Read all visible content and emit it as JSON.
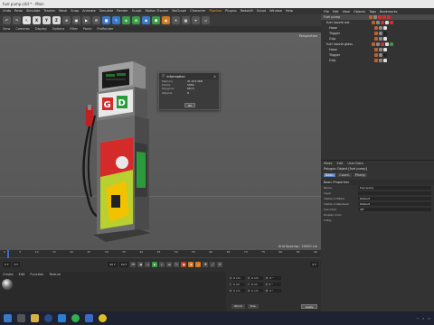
{
  "window": {
    "title": "fuel pump.c4d * - Main"
  },
  "menubar": [
    "Undo",
    "Redo",
    "Simulate",
    "Tracker",
    "Mesh",
    "Snap",
    "Animate",
    "Simulate",
    "Render",
    "Sculpt",
    "Motion Tracker",
    "MoGraph",
    "Character",
    "Pipeline",
    "Plugins",
    "Redshift",
    "Script",
    "Window",
    "Help"
  ],
  "toolbar_axes": [
    "X",
    "Y",
    "Z"
  ],
  "viewport_menu": [
    "View",
    "Cameras",
    "Display",
    "Options",
    "Filter",
    "Panel",
    "ProRender"
  ],
  "viewport": {
    "label": "Perspective",
    "grid_spacing": "Grid Spacing : 10000 cm"
  },
  "dialog": {
    "title": "Information",
    "rows": [
      {
        "k": "Memory",
        "v": "31.972 MiB"
      },
      {
        "k": "Points",
        "v": "5982"
      },
      {
        "k": "Polygons",
        "v": "6674"
      },
      {
        "k": "Objects",
        "v": "8"
      }
    ],
    "ok": "OK"
  },
  "objects_panel": {
    "menu": [
      "File",
      "Edit",
      "View",
      "Objects",
      "Tags",
      "Bookmarks"
    ],
    "items": [
      {
        "name": "Fuel pump",
        "sel": true
      },
      {
        "name": "fuel nozzle ext",
        "sel": false
      },
      {
        "name": "Hose",
        "sel": false
      },
      {
        "name": "Trigger",
        "sel": false
      },
      {
        "name": "Grip",
        "sel": false
      },
      {
        "name": "fuel nozzle glass",
        "sel": false
      },
      {
        "name": "Hose",
        "sel": false
      },
      {
        "name": "Trigger",
        "sel": false
      },
      {
        "name": "Grip",
        "sel": false
      }
    ]
  },
  "attributes": {
    "menu": [
      "Mode",
      "Edit",
      "User Data"
    ],
    "header": "Polygon Object [fuel pump]",
    "tabs": [
      "Basic",
      "Coord.",
      "Phong"
    ],
    "section": "Basic Properties",
    "props": [
      {
        "k": "Name",
        "v": "fuel pump"
      },
      {
        "k": "Layer",
        "v": ""
      },
      {
        "k": "Visible in Editor",
        "v": "Default"
      },
      {
        "k": "Visible in Renderer",
        "v": "Default"
      },
      {
        "k": "Use Color",
        "v": "Off"
      },
      {
        "k": "Display Color",
        "v": ""
      },
      {
        "k": "X-Ray",
        "v": ""
      }
    ]
  },
  "timeline": {
    "ticks": [
      "0",
      "5",
      "10",
      "15",
      "20",
      "25",
      "30",
      "35",
      "40",
      "45",
      "50",
      "55",
      "60",
      "65",
      "70",
      "75",
      "80",
      "85",
      "90"
    ],
    "start": "0 F",
    "start2": "0 F",
    "end": "90 F",
    "end2": "90 F",
    "current": "0 F"
  },
  "materials_menu": [
    "Create",
    "Edit",
    "Function",
    "Texture"
  ],
  "coords": {
    "rows": [
      {
        "a": "X",
        "av": "0 cm",
        "b": "X",
        "bv": "0 cm",
        "c": "H",
        "cv": "0 °"
      },
      {
        "a": "Y",
        "av": "0 cm",
        "b": "Y",
        "bv": "0 cm",
        "c": "P",
        "cv": "0 °"
      },
      {
        "a": "Z",
        "av": "0 cm",
        "b": "Z",
        "bv": "0 cm",
        "c": "B",
        "cv": "0 °"
      }
    ],
    "mode1": "World",
    "mode2": "Size",
    "apply": "Apply"
  },
  "colors": {
    "accent": "#3a78c8",
    "pump_red": "#d42a2a",
    "pump_green": "#2a9a3a",
    "pump_yellow": "#f2c200"
  }
}
